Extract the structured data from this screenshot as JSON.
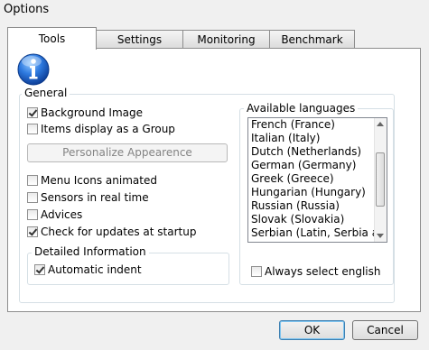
{
  "window": {
    "title": "Options"
  },
  "tabs": [
    {
      "label": "Tools",
      "active": true
    },
    {
      "label": "Settings",
      "active": false
    },
    {
      "label": "Monitoring",
      "active": false
    },
    {
      "label": "Benchmark",
      "active": false
    }
  ],
  "general": {
    "legend": "General",
    "background_image": {
      "label": "Background Image",
      "checked": true
    },
    "items_group": {
      "label": "Items display as a Group",
      "checked": false
    },
    "personalize_button": "Personalize Appearence",
    "menu_icons": {
      "label": "Menu Icons animated",
      "checked": false
    },
    "sensors": {
      "label": "Sensors in real time",
      "checked": false
    },
    "advices": {
      "label": "Advices",
      "checked": false
    },
    "updates": {
      "label": "Check for updates at startup",
      "checked": true
    }
  },
  "detailed": {
    "legend": "Detailed Information",
    "auto_indent": {
      "label": "Automatic indent",
      "checked": true
    }
  },
  "languages": {
    "legend": "Available languages",
    "items": [
      "French (France)",
      "Italian (Italy)",
      "Dutch (Netherlands)",
      "German (Germany)",
      "Greek (Greece)",
      "Hungarian (Hungary)",
      "Russian (Russia)",
      "Slovak (Slovakia)",
      "Serbian (Latin, Serbia and Montenegro)"
    ],
    "always_english": {
      "label": "Always select english",
      "checked": false
    }
  },
  "buttons": {
    "ok": "OK",
    "cancel": "Cancel"
  },
  "icons": {
    "info": "info-icon"
  },
  "colors": {
    "info_blue": "#1c5fd1",
    "group_border": "#d5dfe5"
  }
}
